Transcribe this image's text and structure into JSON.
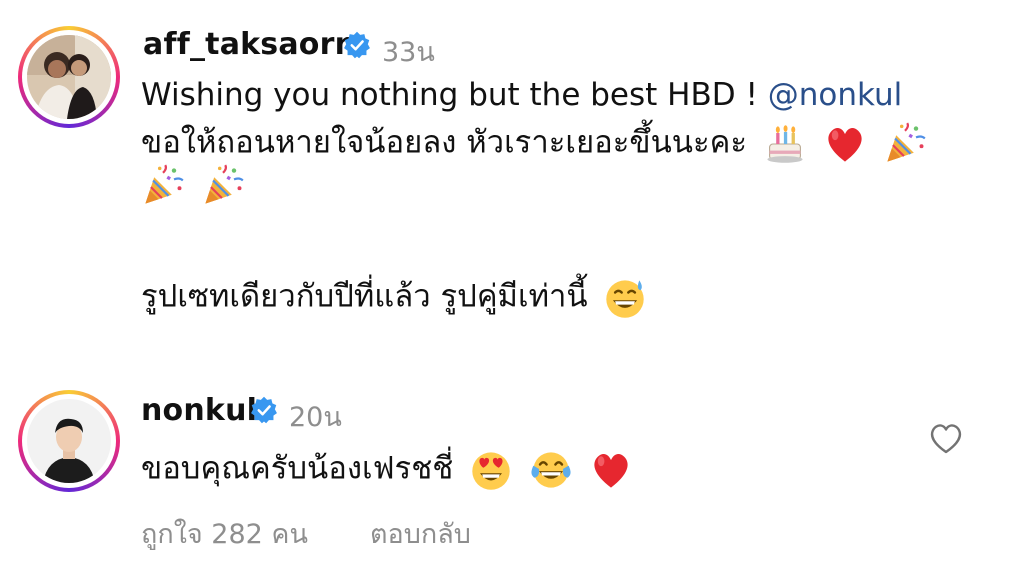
{
  "comments": [
    {
      "username": "aff_taksaorn",
      "time": "33น",
      "line1_text": "Wishing you nothing but the best HBD ! ",
      "mention": "@nonkul",
      "line2_text": "ขอให้ถอนหายใจน้อยลง หัวเราะเยอะขึ้นนะคะ",
      "line4_text": "รูปเซทเดียวกับปีที่แล้ว รูปคู่มีเท่านี้"
    },
    {
      "username": "nonkul",
      "time": "20น",
      "line1_text": "ขอบคุณครับน้องเฟรชชี่",
      "likes": "ถูกใจ 282 คน",
      "reply": "ตอบกลับ"
    }
  ],
  "icons": {
    "verified": "verified-badge-icon",
    "heart": "heart-outline-icon",
    "cake": "birthday-cake-emoji",
    "red_heart": "red-heart-emoji",
    "party_popper": "party-popper-emoji",
    "grin_sweat": "grinning-sweat-emoji",
    "heart_eyes": "heart-eyes-emoji",
    "joy": "tears-of-joy-emoji"
  },
  "colors": {
    "verified_blue": "#3897f0",
    "muted_text": "#8e8e8e",
    "mention_blue": "#2a4f8a"
  }
}
